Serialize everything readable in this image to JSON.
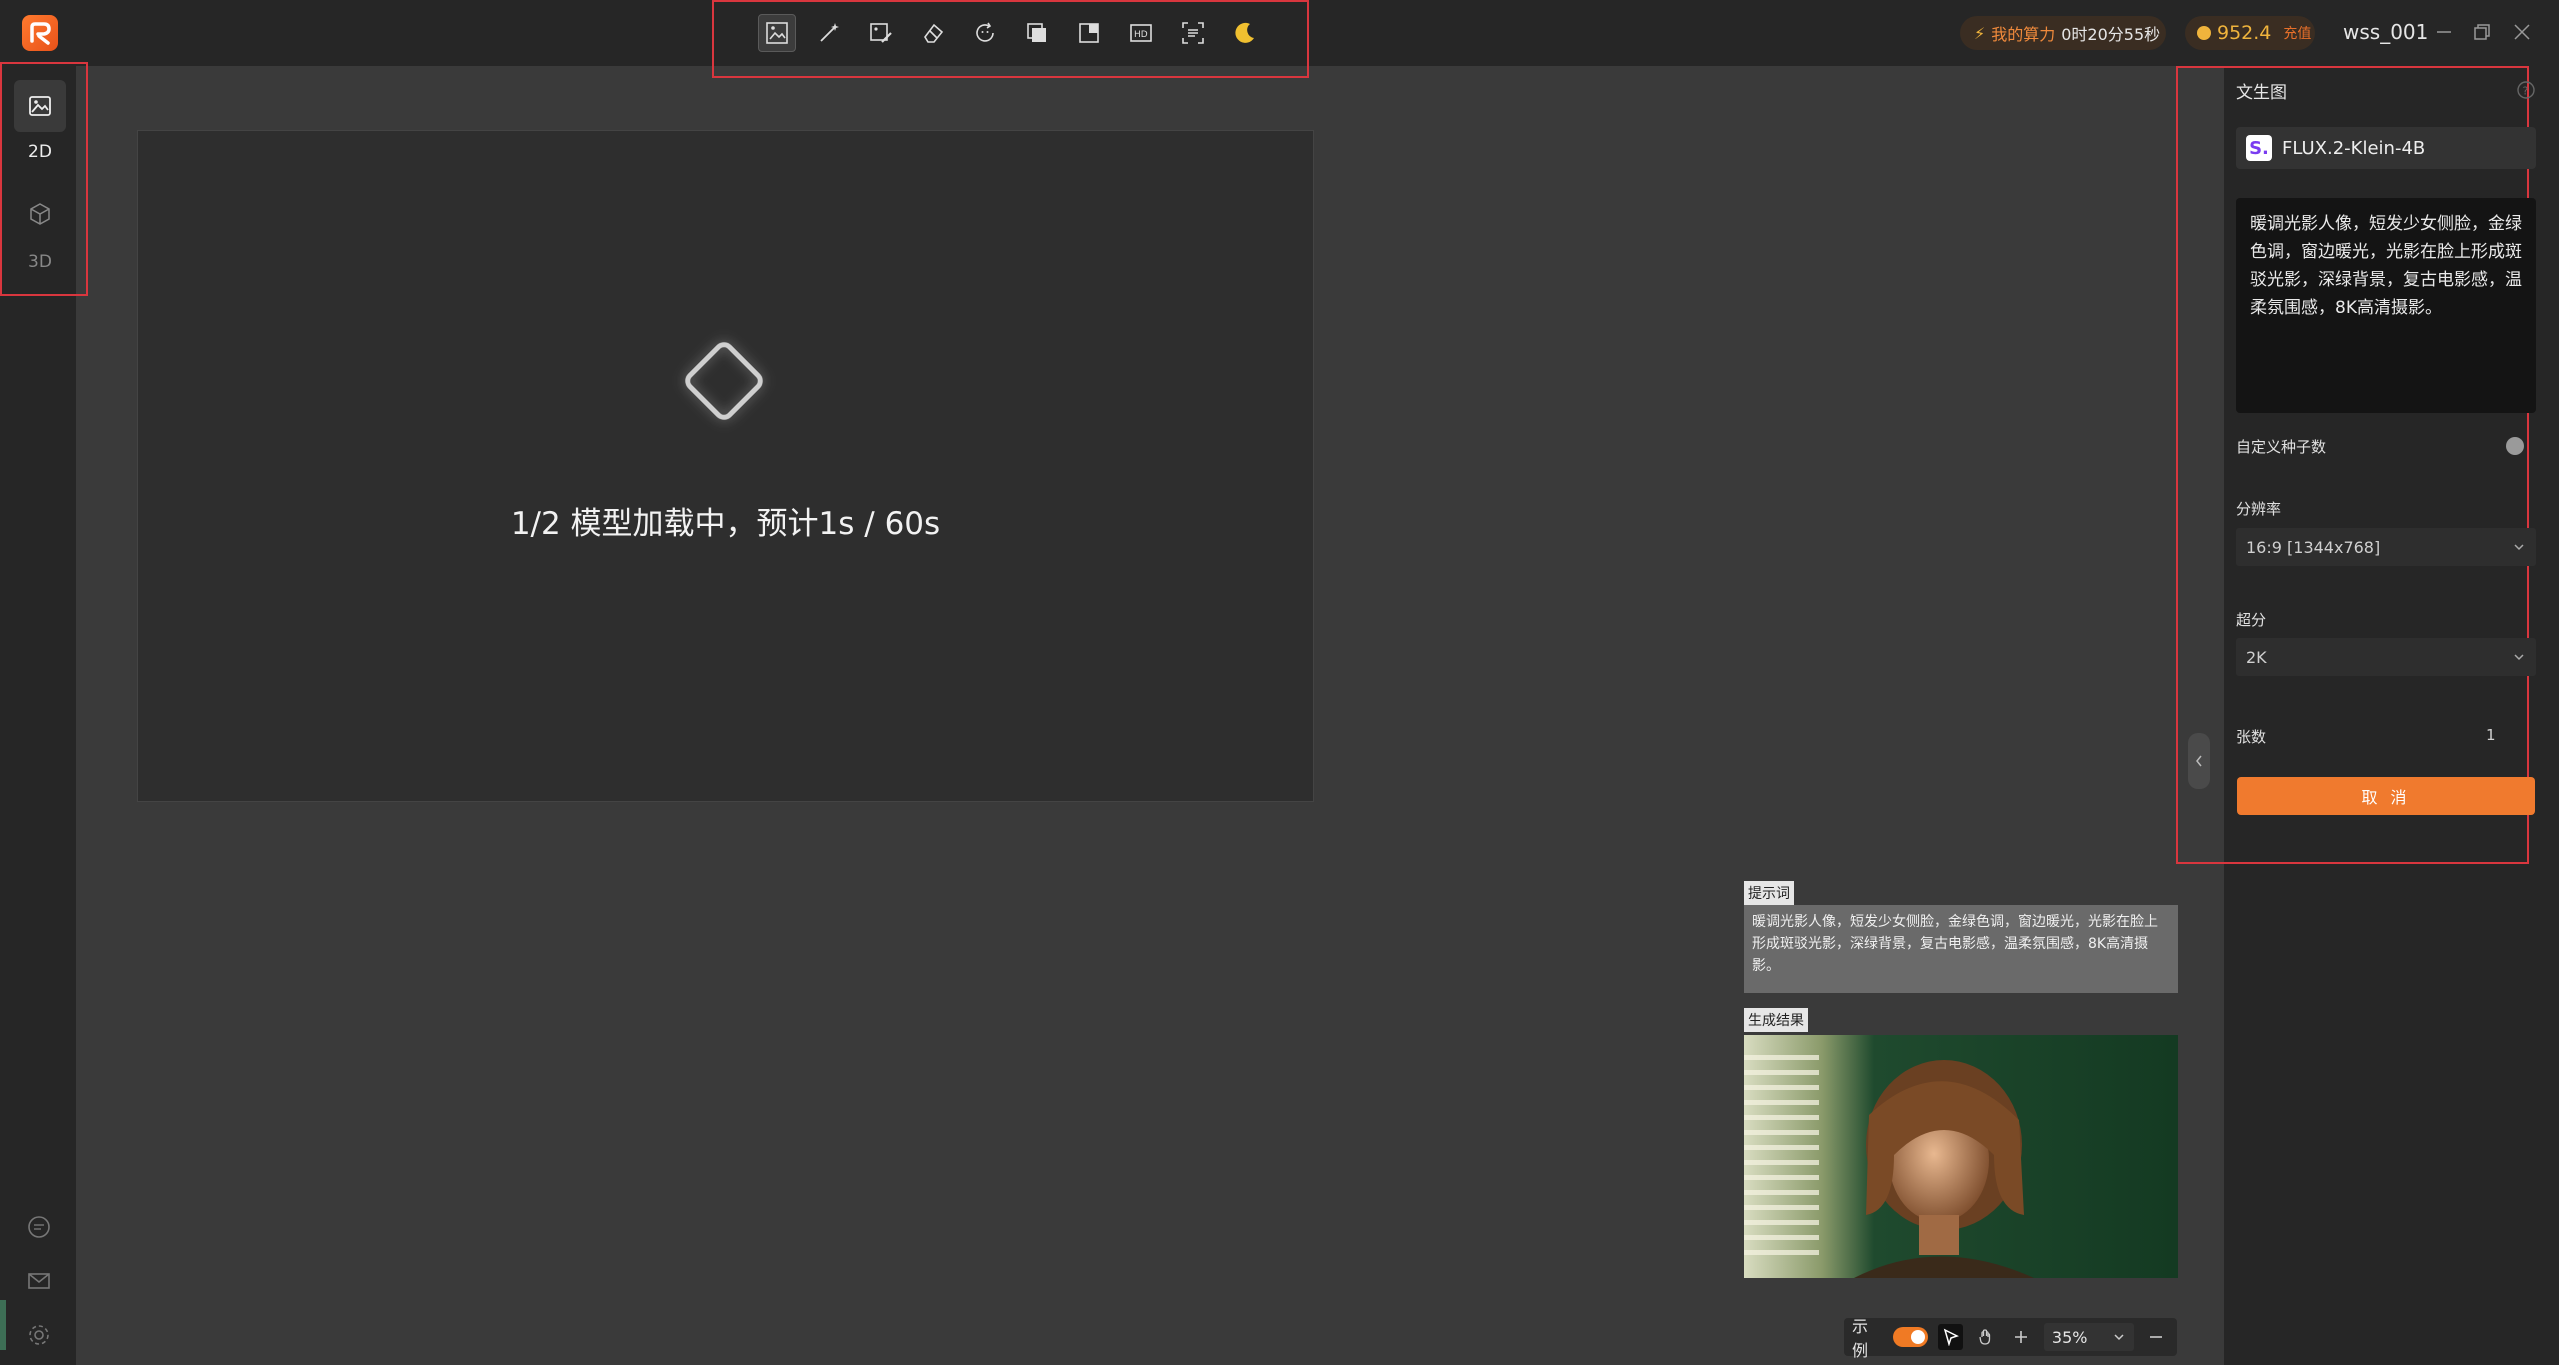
{
  "topbar": {
    "power_label": "我的算力",
    "power_value": "0时20分55秒",
    "coins": "952.4",
    "recharge": "充值",
    "username": "wss_001"
  },
  "toolbar": {
    "icons": [
      "image-edit-icon",
      "magic-wand-icon",
      "image-brush-icon",
      "eraser-icon",
      "face-swap-icon",
      "layers-icon",
      "expand-icon",
      "hd-icon",
      "scan-text-icon",
      "moon-icon"
    ]
  },
  "sidebar": {
    "modes": [
      {
        "label": "2D"
      },
      {
        "label": "3D"
      }
    ]
  },
  "canvas": {
    "loading_text": "1/2 模型加载中，预计1s / 60s"
  },
  "preview": {
    "prompt_tag": "提示词",
    "prompt_text": "暖调光影人像，短发少女侧脸，金绿色调，窗边暖光，光影在脸上形成斑驳光影，深绿背景，复古电影感，温柔氛围感，8K高清摄影。",
    "result_tag": "生成结果"
  },
  "bottom_toolbar": {
    "example_label": "示例",
    "zoom": "35%"
  },
  "panel": {
    "title": "文生图",
    "model_badge": "S.",
    "model_name": "FLUX.2-Klein-4B",
    "prompt": "暖调光影人像，短发少女侧脸，金绿色调，窗边暖光，光影在脸上形成斑驳光影，深绿背景，复古电影感，温柔氛围感，8K高清摄影。",
    "seed_label": "自定义种子数",
    "resolution_label": "分辨率",
    "resolution_value": "16:9 [1344x768]",
    "upscale_label": "超分",
    "upscale_value": "2K",
    "count_label": "张数",
    "count_value": "1",
    "cancel_label": "取 消"
  },
  "colors": {
    "accent": "#f07a2e",
    "highlight_box": "#d9363e"
  }
}
